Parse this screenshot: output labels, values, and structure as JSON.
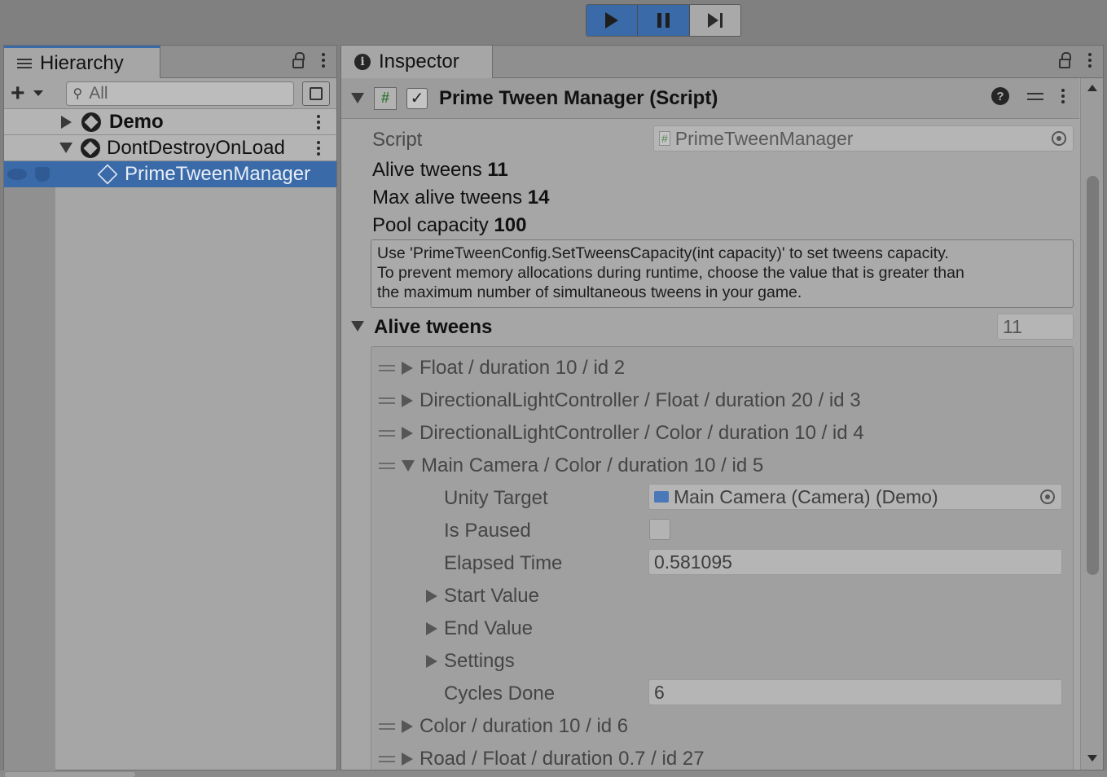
{
  "toolbar": {
    "play_icon": "play-icon",
    "pause_icon": "pause-icon",
    "step_icon": "step-icon"
  },
  "hierarchy": {
    "tab_label": "Hierarchy",
    "search_placeholder": "All",
    "items": [
      {
        "label": "Demo",
        "type": "scene",
        "expanded": false
      },
      {
        "label": "DontDestroyOnLoad",
        "type": "scene",
        "expanded": true
      },
      {
        "label": "PrimeTweenManager",
        "type": "gameobject",
        "selected": true
      }
    ]
  },
  "inspector": {
    "tab_label": "Inspector",
    "component_title": "Prime Tween Manager (Script)",
    "script_label": "Script",
    "script_value": "PrimeTweenManager",
    "alive_tweens_label": "Alive tweens",
    "alive_tweens_value": "11",
    "max_alive_label": "Max alive tweens",
    "max_alive_value": "14",
    "pool_capacity_label": "Pool capacity",
    "pool_capacity_value": "100",
    "help_lines": [
      "Use 'PrimeTweenConfig.SetTweensCapacity(int capacity)' to set tweens capacity.",
      "To prevent memory allocations during runtime, choose the value that is greater than",
      "the maximum number of simultaneous tweens in your game."
    ],
    "alive_section_label": "Alive tweens",
    "alive_section_count": "11",
    "tweens": [
      "Float / duration 10 / id 2",
      "DirectionalLightController / Float / duration 20 / id 3",
      "DirectionalLightController / Color / duration 10 / id 4",
      "Main Camera / Color / duration 10 / id 5",
      "Color / duration 10 / id 6",
      "Road / Float / duration 0.7 / id 27"
    ],
    "expanded_tween": {
      "unity_target_label": "Unity Target",
      "unity_target_value": "Main Camera (Camera) (Demo)",
      "is_paused_label": "Is Paused",
      "elapsed_label": "Elapsed Time",
      "elapsed_value": "0.581095",
      "start_value_label": "Start Value",
      "end_value_label": "End Value",
      "settings_label": "Settings",
      "cycles_label": "Cycles Done",
      "cycles_value": "6"
    }
  },
  "colors": {
    "accent": "#3a6aa8",
    "panel_bg": "#a6a6a6",
    "background": "#808080"
  }
}
